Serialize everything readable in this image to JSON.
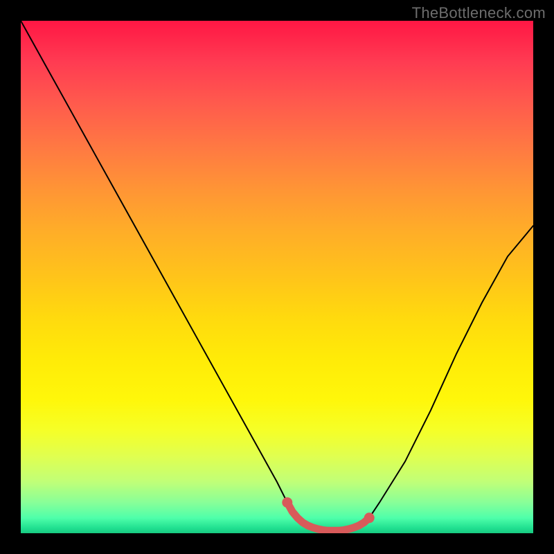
{
  "watermark": "TheBottleneck.com",
  "chart_data": {
    "type": "line",
    "title": "",
    "xlabel": "",
    "ylabel": "",
    "xlim": [
      0,
      100
    ],
    "ylim": [
      0,
      100
    ],
    "grid": false,
    "series": [
      {
        "name": "bottleneck-curve",
        "color": "#000000",
        "x": [
          0,
          5,
          10,
          15,
          20,
          25,
          30,
          35,
          40,
          45,
          50,
          52,
          54,
          56,
          58,
          60,
          62,
          64,
          66,
          68,
          70,
          75,
          80,
          85,
          90,
          95,
          100
        ],
        "y": [
          100,
          91,
          82,
          73,
          64,
          55,
          46,
          37,
          28,
          19,
          10,
          6,
          3,
          1.5,
          0.8,
          0.5,
          0.5,
          0.8,
          1.5,
          3,
          6,
          14,
          24,
          35,
          45,
          54,
          60
        ]
      },
      {
        "name": "optimal-range-marker",
        "color": "#d85a5a",
        "x": [
          52,
          53,
          54,
          55,
          56,
          57,
          58,
          59,
          60,
          61,
          62,
          63,
          64,
          65,
          66,
          67,
          68
        ],
        "y": [
          6,
          4.2,
          3,
          2.1,
          1.5,
          1.1,
          0.8,
          0.6,
          0.5,
          0.5,
          0.5,
          0.6,
          0.8,
          1.1,
          1.5,
          2.1,
          3
        ]
      }
    ],
    "colors": {
      "gradient_top": "#ff1744",
      "gradient_mid": "#ffeb08",
      "gradient_bottom": "#18c880",
      "curve": "#000000",
      "marker": "#d85a5a"
    }
  }
}
